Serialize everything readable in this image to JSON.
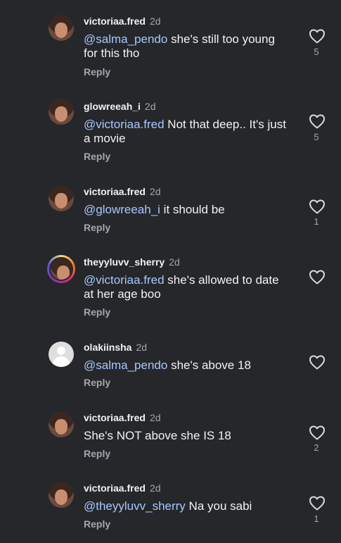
{
  "comments": [
    {
      "username": "victoriaa.fred",
      "time": "2d",
      "mention": "@salma_pendo",
      "text": " she's still too young for this tho",
      "reply": "Reply",
      "likes": "5"
    },
    {
      "username": "glowreeah_i",
      "time": "2d",
      "mention": "@victoriaa.fred",
      "text": " Not that deep.. It's just a movie",
      "reply": "Reply",
      "likes": "5"
    },
    {
      "username": "victoriaa.fred",
      "time": "2d",
      "mention": "@glowreeah_i",
      "text": " it should be",
      "reply": "Reply",
      "likes": "1"
    },
    {
      "username": "theyyluvv_sherry",
      "time": "2d",
      "mention": "@victoriaa.fred",
      "text": " she's allowed to date at her age boo",
      "reply": "Reply",
      "likes": ""
    },
    {
      "username": "olakiinsha",
      "time": "2d",
      "mention": "@salma_pendo",
      "text": " she's above 18",
      "reply": "Reply",
      "likes": ""
    },
    {
      "username": "victoriaa.fred",
      "time": "2d",
      "mention": "",
      "text": "She's NOT above she IS 18",
      "reply": "Reply",
      "likes": "2"
    },
    {
      "username": "victoriaa.fred",
      "time": "2d",
      "mention": "@theyyluvv_sherry",
      "text": " Na you sabi",
      "reply": "Reply",
      "likes": "1"
    }
  ],
  "icons": {
    "like": "heart-outline-icon",
    "avatar_default": "default-avatar-icon"
  },
  "colors": {
    "background": "#25272b",
    "mention": "#a9c7ff",
    "secondary": "#a3a6ab"
  }
}
